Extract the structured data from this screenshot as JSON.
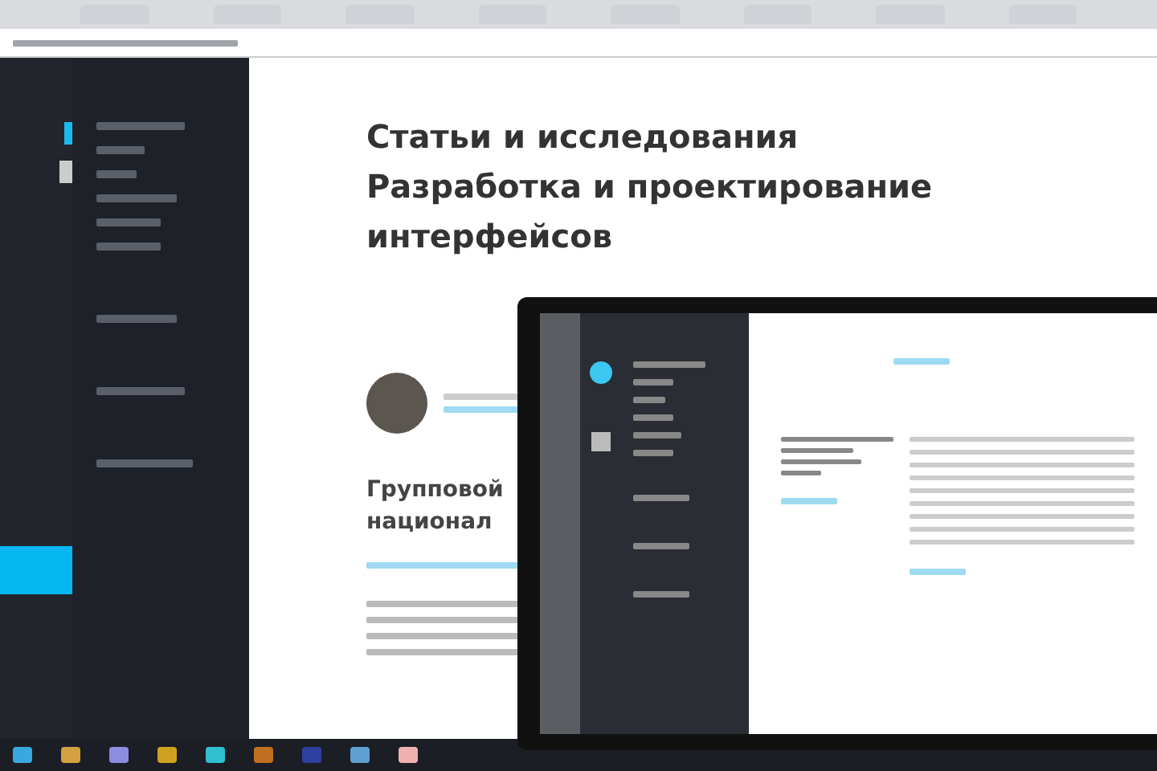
{
  "page": {
    "heading_lines": [
      "Статьи и исследования",
      "Разработка и проектирование",
      "интерфейсов"
    ],
    "article_title_lines": [
      "Групповой",
      "национал"
    ]
  }
}
